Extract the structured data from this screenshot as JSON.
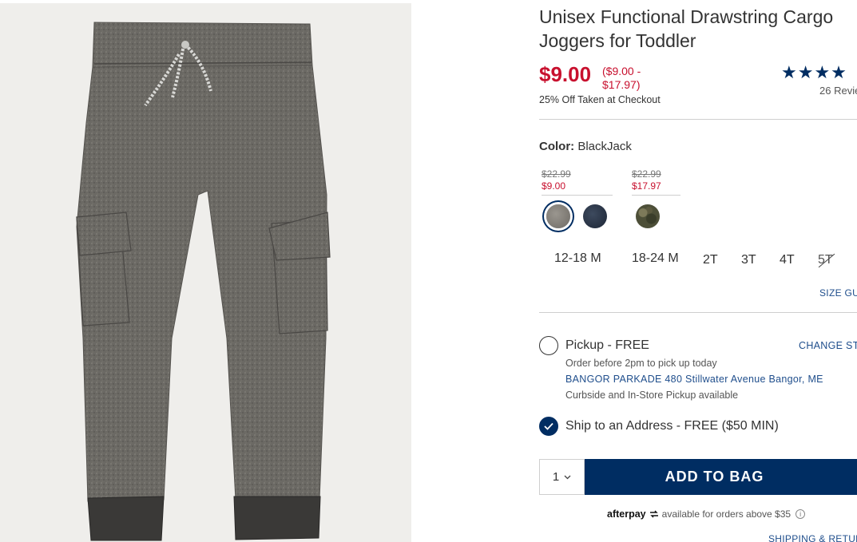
{
  "product": {
    "title": "Unisex Functional Drawstring Cargo Joggers for Toddler",
    "price": "$9.00",
    "price_range": "($9.00 - $17.97)",
    "promo": "25% Off Taken at Checkout",
    "rating_stars": "★★★★",
    "rating_value": 4,
    "review_count": "26 Revie"
  },
  "color": {
    "label": "Color:",
    "value": "BlackJack",
    "price_groups": [
      {
        "old": "$22.99",
        "new": "$9.00"
      },
      {
        "old": "$22.99",
        "new": "$17.97"
      }
    ],
    "swatches": [
      {
        "name": "heather-gray",
        "color": "#86827b",
        "selected": true
      },
      {
        "name": "navy",
        "color": "#2a3446",
        "selected": false
      },
      {
        "name": "camo",
        "color": "#4d4f38",
        "selected": false
      }
    ]
  },
  "sizes": [
    {
      "label": "12-18 M",
      "available": true
    },
    {
      "label": "18-24 M",
      "available": true
    },
    {
      "label": "2T",
      "available": true
    },
    {
      "label": "3T",
      "available": true
    },
    {
      "label": "4T",
      "available": true
    },
    {
      "label": "5T",
      "available": false
    }
  ],
  "size_guide": "SIZE GU",
  "pickup": {
    "title": "Pickup - FREE",
    "change_store": "CHANGE STO",
    "note": "Order before 2pm to pick up today",
    "store": "BANGOR PARKADE 480 Stillwater Avenue  Bangor, ME",
    "curbside": "Curbside and In-Store Pickup available",
    "selected": false
  },
  "ship": {
    "title": "Ship to an Address - FREE ($50 MIN)",
    "selected": true
  },
  "cart": {
    "quantity": "1",
    "add_to_bag": "ADD TO BAG"
  },
  "afterpay": {
    "logo": "afterpay",
    "text": "available for orders above $35"
  },
  "shipping_returns": "SHIPPING & RETUR",
  "colors": {
    "accent_navy": "#002d62",
    "sale_red": "#c8102e",
    "link_blue": "#1f4e8c"
  }
}
